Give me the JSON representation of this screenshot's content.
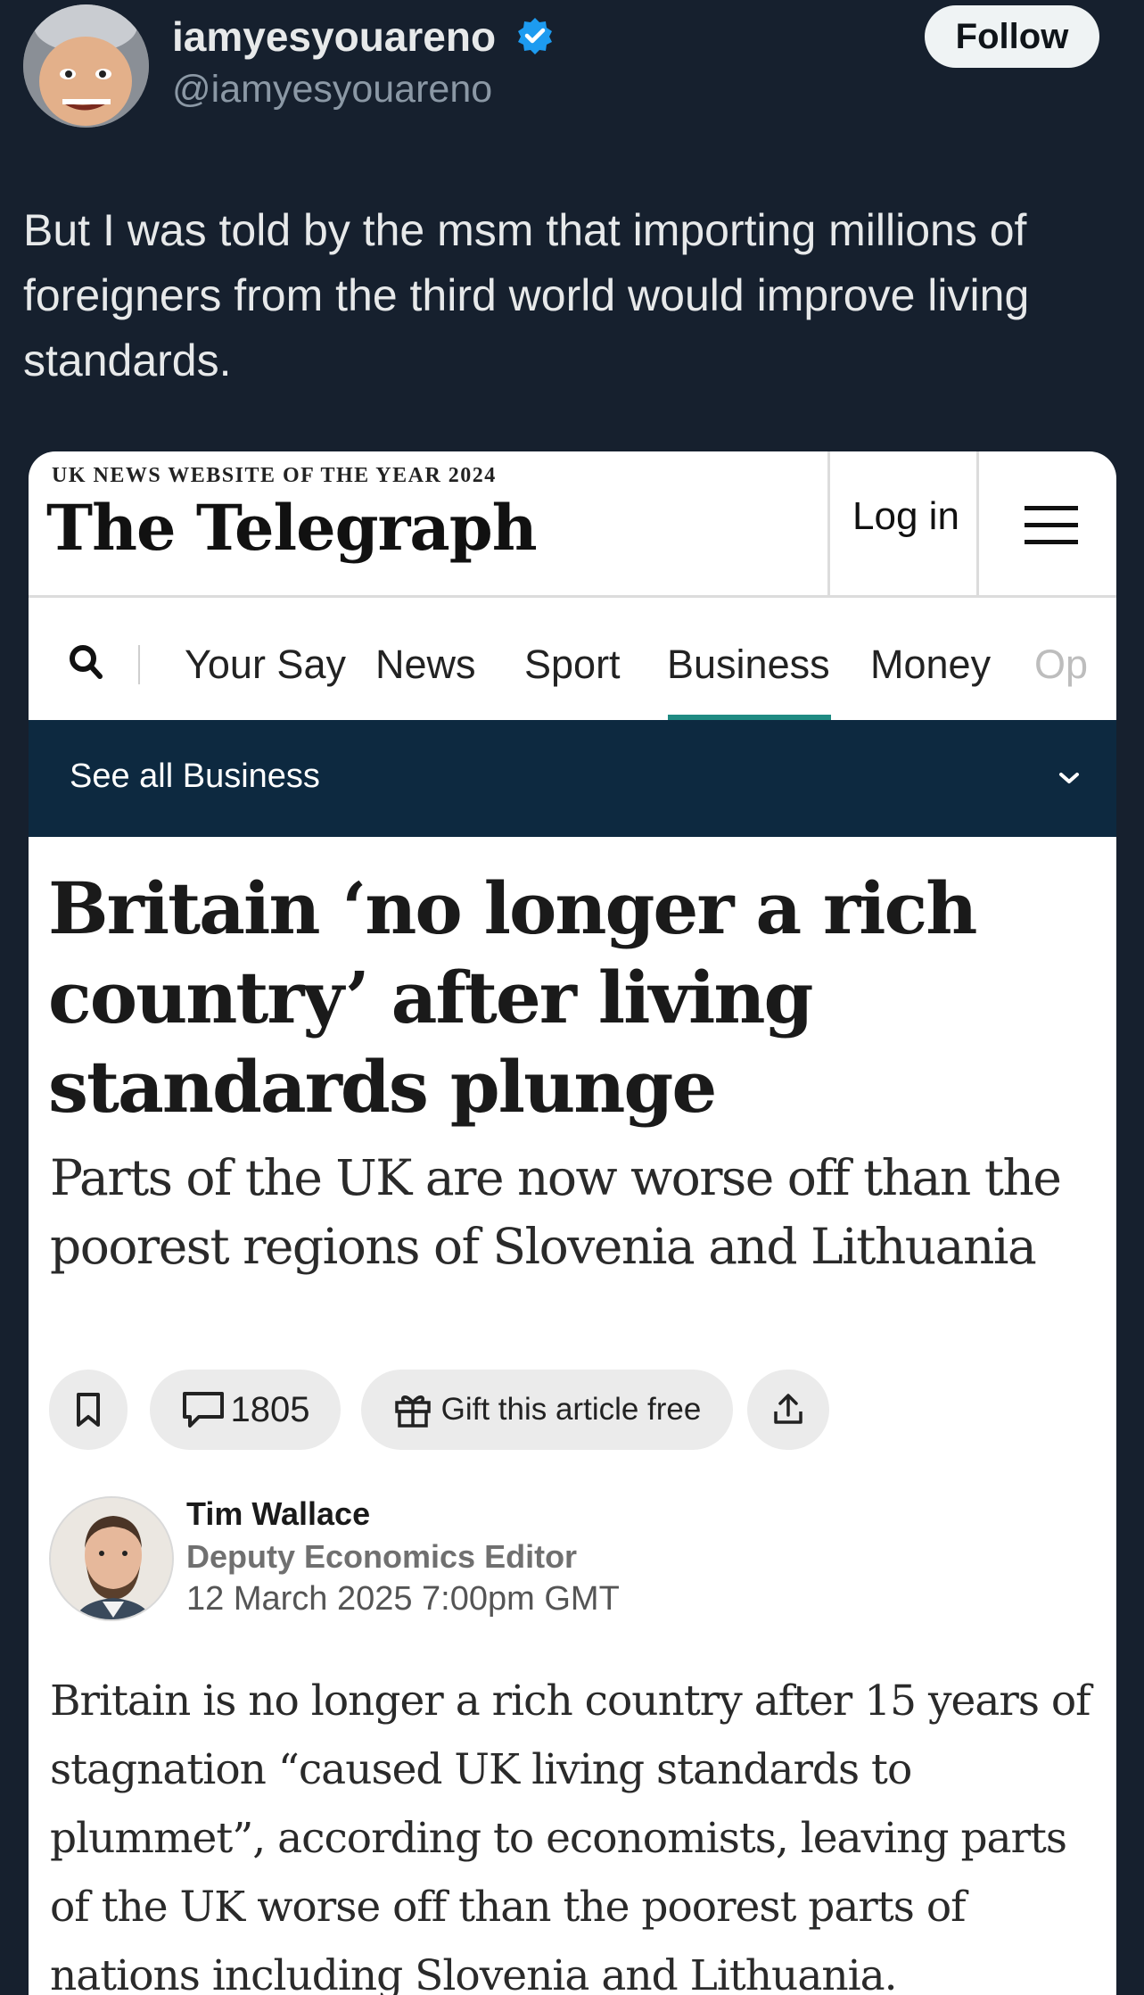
{
  "tweet": {
    "display_name": "iamyesyouareno",
    "handle": "@iamyesyouareno",
    "follow_label": "Follow",
    "text": "But I was told by the msm that importing millions of foreigners from the third world would improve living standards."
  },
  "site": {
    "award": "UK NEWS WEBSITE OF THE YEAR 2024",
    "brand": "The Telegraph",
    "login_label": "Log in"
  },
  "nav": {
    "items": [
      {
        "label": "Your Say"
      },
      {
        "label": "News"
      },
      {
        "label": "Sport"
      },
      {
        "label": "Business"
      },
      {
        "label": "Money"
      },
      {
        "label": "Op"
      }
    ],
    "active": "Business"
  },
  "subnav": {
    "label": "See all Business"
  },
  "article": {
    "headline": "Britain ‘no longer a rich country’ after living standards plunge",
    "standfirst": "Parts of the UK are now worse off than the poorest regions of Slovenia and Lithuania",
    "comments_count": "1805",
    "gift_label": "Gift this article free",
    "author_name": "Tim Wallace",
    "author_role": "Deputy Economics Editor",
    "date": "12 March 2025 7:00pm GMT",
    "body": "Britain is no longer a rich country after 15 years of stagnation “caused UK living standards to plummet”, according to economists, leaving parts of the UK worse off than the poorest parts of nations including Slovenia and Lithuania."
  },
  "colors": {
    "page_bg": "#16202e",
    "subnav_bg": "#0d2940",
    "active_underline": "#1f8a82",
    "verified_blue": "#1d9bf0"
  },
  "icons": [
    "verified-badge-icon",
    "search-icon",
    "menu-icon",
    "chevron-down-icon",
    "bookmark-icon",
    "comment-icon",
    "gift-icon",
    "share-icon"
  ]
}
